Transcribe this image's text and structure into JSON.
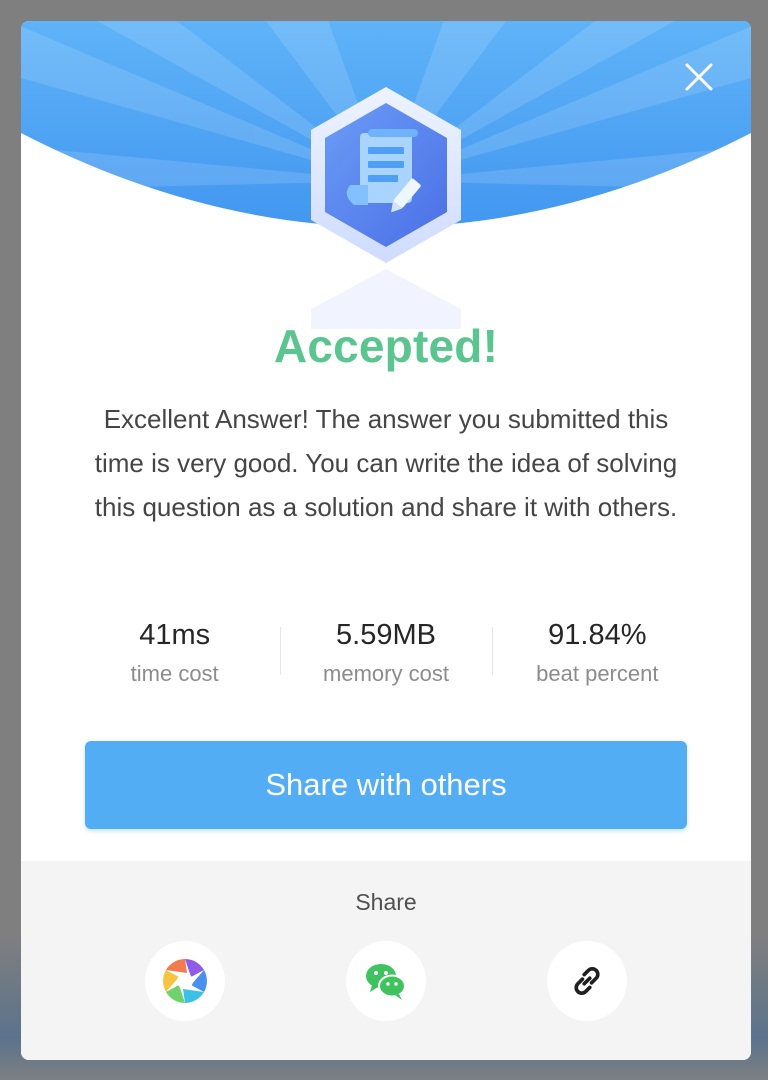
{
  "result": {
    "title": "Accepted!",
    "message": "Excellent Answer! The answer you submitted this time is very good. You can write the idea of solving this question as a solution and share it with others."
  },
  "stats": [
    {
      "value": "41ms",
      "label": "time cost"
    },
    {
      "value": "5.59MB",
      "label": "memory cost"
    },
    {
      "value": "91.84%",
      "label": "beat percent"
    }
  ],
  "actions": {
    "share_button_label": "Share with others"
  },
  "share": {
    "title": "Share",
    "options": [
      {
        "icon": "pinwheel-app-icon"
      },
      {
        "icon": "wechat-icon"
      },
      {
        "icon": "link-icon"
      }
    ]
  },
  "colors": {
    "accepted_green": "#5ac58f",
    "primary_blue": "#52adf5",
    "banner_blue": "#3f96ef"
  }
}
